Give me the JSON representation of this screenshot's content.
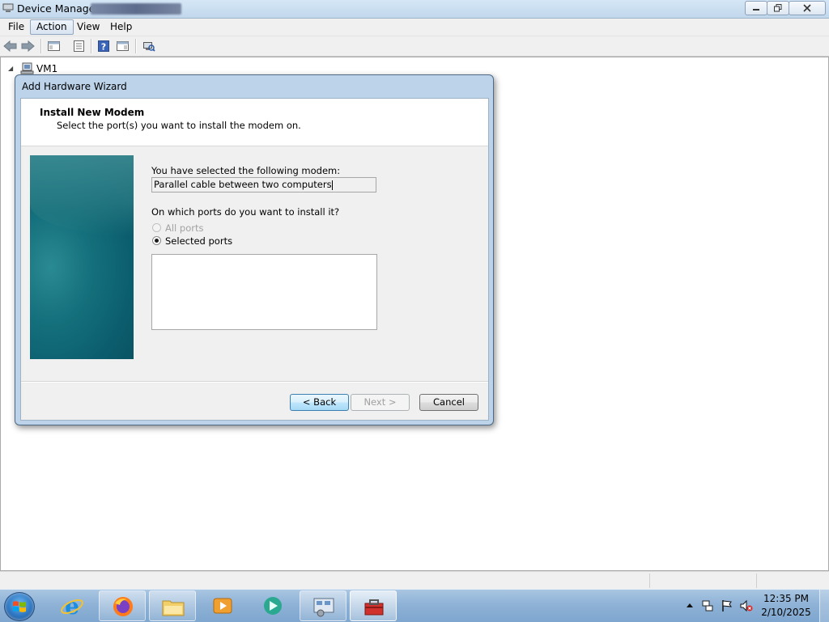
{
  "window": {
    "title": "Device Manager",
    "menu": [
      "File",
      "Action",
      "View",
      "Help"
    ]
  },
  "toolbar": {
    "icons": [
      "back-arrow-icon",
      "forward-arrow-icon",
      "show-hide-console-tree-icon",
      "properties-icon",
      "help-icon",
      "action-pane-icon",
      "scan-hardware-changes-icon"
    ]
  },
  "tree": {
    "root_label": "VM1"
  },
  "wizard": {
    "title": "Add Hardware Wizard",
    "heading": "Install New Modem",
    "subheading": "Select the port(s) you want to install the modem on.",
    "selected_label": "You have selected the following modem:",
    "modem_value": "Parallel cable between two computers",
    "ports_question": "On which ports do you want to install it?",
    "radio_all": "All ports",
    "radio_selected": "Selected ports",
    "radio_choice": "Selected ports",
    "ports_list": [],
    "buttons": {
      "back": "< Back",
      "next": "Next >",
      "cancel": "Cancel"
    }
  },
  "taskbar": {
    "apps": [
      "internet-explorer-icon",
      "firefox-icon",
      "file-explorer-icon",
      "media-player-icon",
      "app-icon",
      "device-manager-icon",
      "toolbox-icon"
    ],
    "clock_time": "12:35 PM",
    "clock_date": "2/10/2025"
  },
  "colors": {
    "wizard_frame": "#bcd3ea",
    "wizard_graphic": "#0b5d6d",
    "taskbar": "#8fb2d6"
  }
}
